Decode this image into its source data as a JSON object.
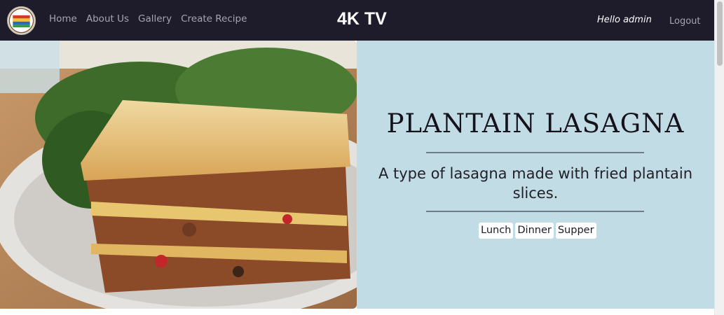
{
  "navbar": {
    "logo_icon": "flag-globe-logo",
    "links": [
      "Home",
      "About Us",
      "Gallery",
      "Create Recipe"
    ],
    "brand": "4K TV",
    "greeting": "Hello admin",
    "logout": "Logout"
  },
  "hero": {
    "image": "lasagna-photo",
    "title": "PLANTAIN LASAGNA",
    "description": "A type of lasagna made with fried plantain slices.",
    "tags": [
      "Lunch",
      "Dinner",
      "Supper"
    ],
    "colors": {
      "panel_bg": "#c1dce4",
      "nav_bg": "#1e1b2b"
    }
  }
}
